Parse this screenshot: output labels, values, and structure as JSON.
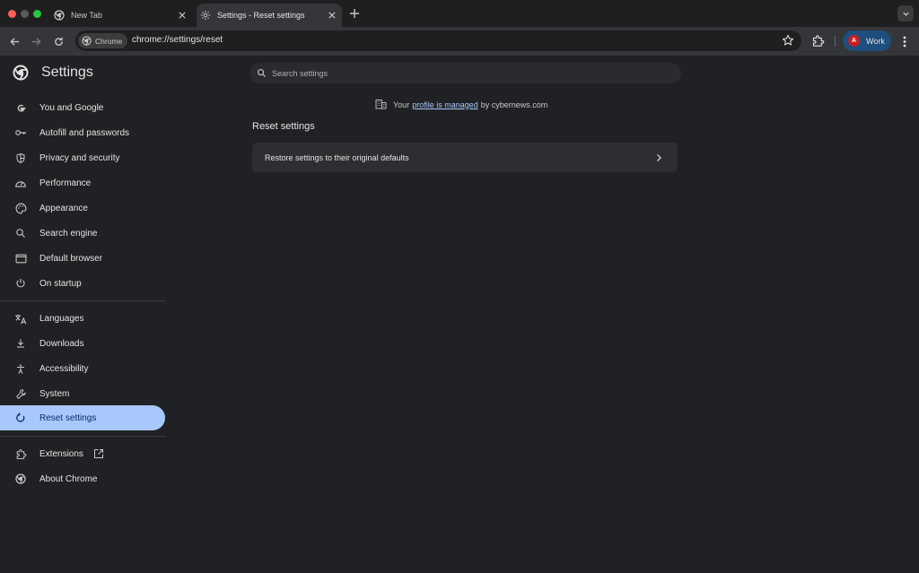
{
  "tabs": [
    {
      "title": "New Tab",
      "active": false
    },
    {
      "title": "Settings - Reset settings",
      "active": true
    }
  ],
  "toolbar": {
    "chip_label": "Chrome",
    "url": "chrome://settings/reset",
    "profile_initial": "A",
    "profile_label": "Work"
  },
  "settings": {
    "header_title": "Settings",
    "search_placeholder": "Search settings",
    "sidebar": {
      "group1": [
        {
          "label": "You and Google",
          "icon": "google-icon"
        },
        {
          "label": "Autofill and passwords",
          "icon": "key-icon"
        },
        {
          "label": "Privacy and security",
          "icon": "shield-icon"
        },
        {
          "label": "Performance",
          "icon": "speedometer-icon"
        },
        {
          "label": "Appearance",
          "icon": "palette-icon"
        },
        {
          "label": "Search engine",
          "icon": "search-icon"
        },
        {
          "label": "Default browser",
          "icon": "browser-window-icon"
        },
        {
          "label": "On startup",
          "icon": "power-icon"
        }
      ],
      "group2": [
        {
          "label": "Languages",
          "icon": "translate-icon"
        },
        {
          "label": "Downloads",
          "icon": "download-icon"
        },
        {
          "label": "Accessibility",
          "icon": "accessibility-icon"
        },
        {
          "label": "System",
          "icon": "wrench-icon"
        },
        {
          "label": "Reset settings",
          "icon": "reset-icon",
          "active": true
        }
      ],
      "group3": [
        {
          "label": "Extensions",
          "icon": "puzzle-icon"
        },
        {
          "label": "About Chrome",
          "icon": "chrome-icon"
        }
      ]
    },
    "managed": {
      "prefix": "Your",
      "link": "profile is managed",
      "suffix": "by cybernews.com"
    },
    "section_title": "Reset settings",
    "restore_label": "Restore settings to their original defaults"
  },
  "colors": {
    "background": "#202124",
    "active_item": "#a8c7fa",
    "link": "#a8c7fa"
  }
}
